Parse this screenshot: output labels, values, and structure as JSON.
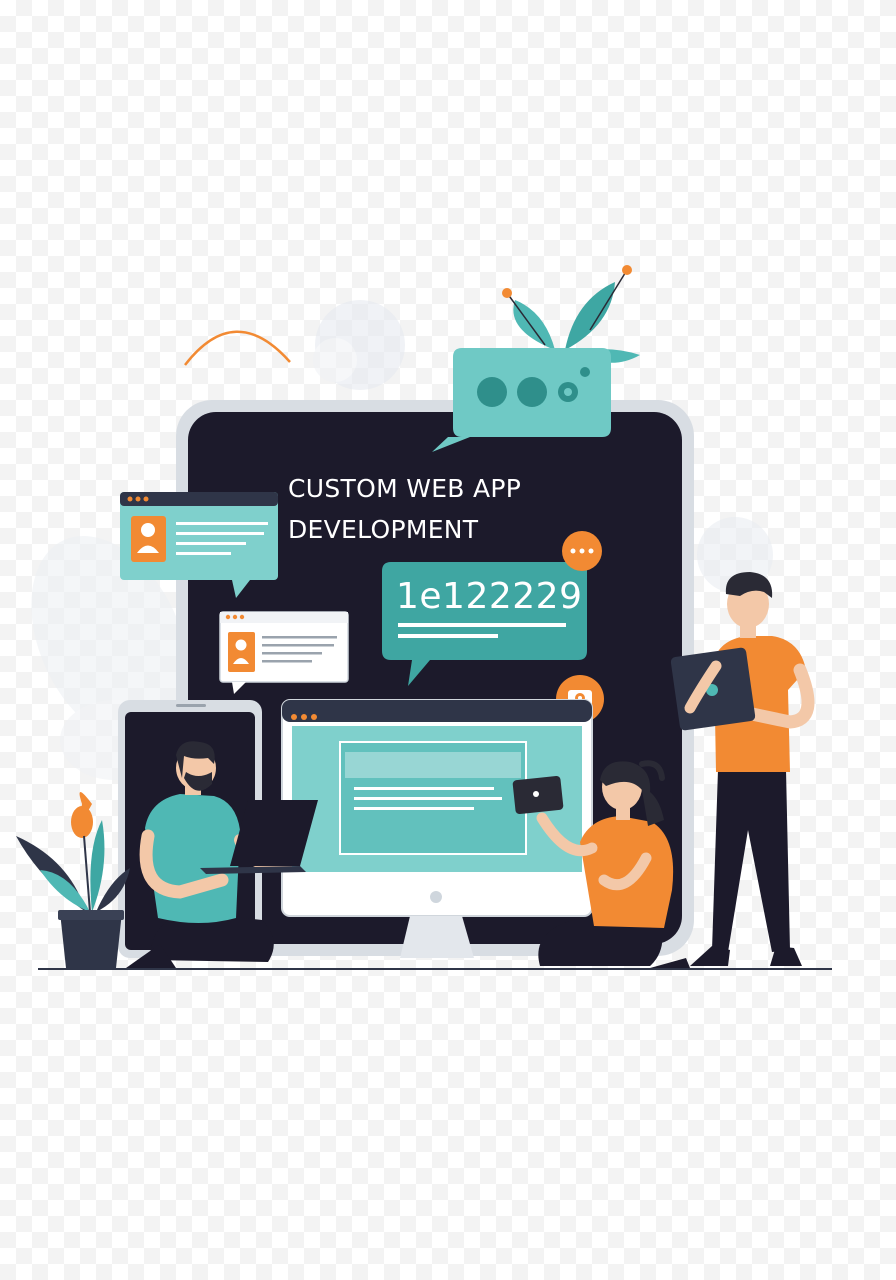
{
  "headline": {
    "line1": "CUSTOM WEB APP",
    "line2": "DEVELOPMENT"
  },
  "code_bubble": {
    "value": "1e122229"
  },
  "colors": {
    "monitor_dark": "#1c1a2b",
    "teal": "#4fb8b4",
    "teal_light": "#8fdcd8",
    "orange": "#f28a33",
    "outline_gray": "#d8dde3",
    "skin": "#f3c8a8",
    "hair": "#2a2a35"
  },
  "icons": [
    "chat-bubble-icon",
    "user-card-icon",
    "cloud-icon",
    "ellipsis-icon",
    "camera-icon",
    "plant-icon"
  ]
}
